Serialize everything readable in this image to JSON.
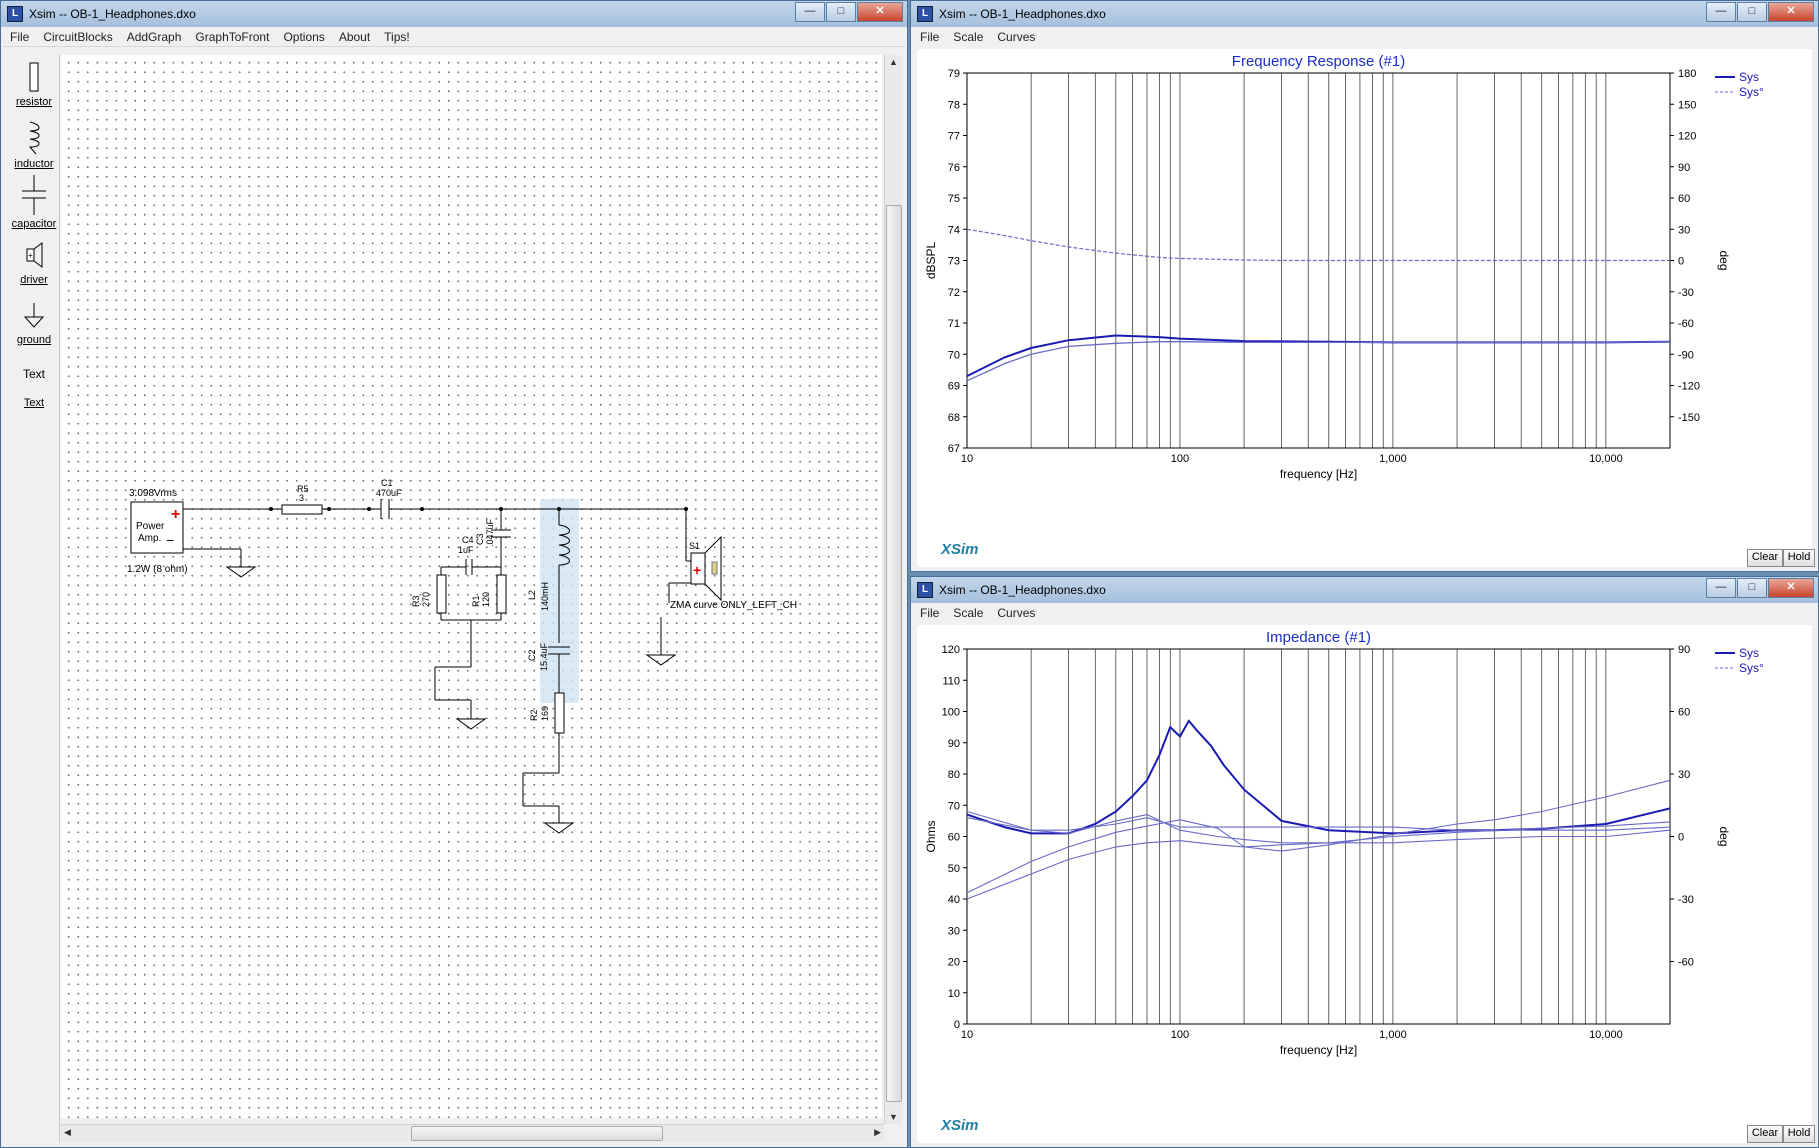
{
  "colors": {
    "series_main": "#1a1ab4",
    "series_phase": "#6a6ac8",
    "grid": "#000000",
    "title": "#1a2ec4"
  },
  "schematic": {
    "title": "Xsim -- OB-1_Headphones.dxo",
    "menu": [
      "File",
      "CircuitBlocks",
      "AddGraph",
      "GraphToFront",
      "Options",
      "About",
      "Tips!"
    ],
    "tools": [
      {
        "label": "resistor",
        "icon": "resistor-icon"
      },
      {
        "label": "inductor",
        "icon": "inductor-icon"
      },
      {
        "label": "capacitor",
        "icon": "capacitor-icon"
      },
      {
        "label": "driver",
        "icon": "driver-icon"
      },
      {
        "label": "ground",
        "icon": "ground-icon"
      },
      {
        "label": "Text",
        "icon": "text-plain"
      },
      {
        "label": "Text",
        "icon": "text-underlined"
      }
    ],
    "circuit": {
      "source_voltage": "3.098Vrms",
      "source_name": "Power",
      "source_name2": "Amp.",
      "source_power": "1.2W (8 ohm)",
      "r5_name": "R5",
      "r5_value": "3",
      "c1_name": "C1",
      "c1_value": "470uF",
      "c3_name": "C3",
      "c3_value": ".047uF",
      "c4_name": "C4",
      "c4_value": "1uF",
      "r3_name": "R3",
      "r3_value": "270",
      "r1_name": "R1",
      "r1_value": "120",
      "l2_name": "L2",
      "l2_value": "140mH",
      "c2_name": "C2",
      "c2_value": "15.4uF",
      "r2_name": "R2",
      "r2_value": "169",
      "s1_name": "S1",
      "s1_curve": "ZMA curve ONLY_LEFT_CH"
    }
  },
  "freq_window": {
    "title": "Xsim -- OB-1_Headphones.dxo",
    "menu": [
      "File",
      "Scale",
      "Curves"
    ],
    "buttons": {
      "clear": "Clear",
      "hold": "Hold"
    },
    "logo": "XSim"
  },
  "imp_window": {
    "title": "Xsim -- OB-1_Headphones.dxo",
    "menu": [
      "File",
      "Scale",
      "Curves"
    ],
    "buttons": {
      "clear": "Clear",
      "hold": "Hold"
    },
    "logo": "XSim"
  },
  "chart_data": [
    {
      "type": "line",
      "title": "Frequency Response (#1)",
      "xlabel": "frequency [Hz]",
      "ylabel": "dBSPL",
      "y2label": "deg",
      "xscale": "log",
      "xlim": [
        10,
        20000
      ],
      "ylim": [
        67,
        79
      ],
      "y2lim": [
        -180,
        180
      ],
      "xticks": [
        10,
        100,
        1000,
        10000
      ],
      "xtick_labels": [
        "10",
        "100",
        "1,000",
        "10,000"
      ],
      "yticks": [
        67,
        68,
        69,
        70,
        71,
        72,
        73,
        74,
        75,
        76,
        77,
        78,
        79
      ],
      "y2ticks": [
        -150,
        -120,
        -90,
        -60,
        -30,
        0,
        30,
        60,
        90,
        120,
        150,
        180
      ],
      "grid": true,
      "legend_position": "top-right",
      "series": [
        {
          "name": "Sys",
          "axis": "left",
          "style": "solid",
          "x": [
            10,
            15,
            20,
            30,
            50,
            80,
            100,
            200,
            500,
            1000,
            2000,
            5000,
            10000,
            20000
          ],
          "y": [
            69.3,
            69.9,
            70.2,
            70.45,
            70.6,
            70.55,
            70.5,
            70.42,
            70.4,
            70.38,
            70.38,
            70.38,
            70.38,
            70.4
          ]
        },
        {
          "name": "",
          "axis": "left",
          "style": "solid-light",
          "x": [
            10,
            15,
            20,
            30,
            50,
            80,
            100,
            200,
            500,
            1000,
            2000,
            5000,
            10000,
            20000
          ],
          "y": [
            69.15,
            69.7,
            70.0,
            70.25,
            70.35,
            70.4,
            70.4,
            70.38,
            70.38,
            70.38,
            70.38,
            70.38,
            70.38,
            70.4
          ]
        },
        {
          "name": "Sys°",
          "axis": "right",
          "style": "dashed",
          "x": [
            10,
            15,
            20,
            30,
            50,
            80,
            100,
            200,
            300,
            500,
            1000,
            2000,
            5000,
            10000,
            20000
          ],
          "y": [
            30,
            24,
            19,
            13,
            7,
            3,
            2,
            0.5,
            0,
            0,
            0,
            0,
            0,
            0,
            0
          ]
        }
      ]
    },
    {
      "type": "line",
      "title": "Impedance (#1)",
      "xlabel": "frequency [Hz]",
      "ylabel": "Ohms",
      "y2label": "deg",
      "xscale": "log",
      "xlim": [
        10,
        20000
      ],
      "ylim": [
        0,
        120
      ],
      "y2lim": [
        -90,
        90
      ],
      "xticks": [
        10,
        100,
        1000,
        10000
      ],
      "xtick_labels": [
        "10",
        "100",
        "1,000",
        "10,000"
      ],
      "yticks": [
        0,
        10,
        20,
        30,
        40,
        50,
        60,
        70,
        80,
        90,
        100,
        110,
        120
      ],
      "y2ticks": [
        -60,
        -30,
        0,
        30,
        60,
        90
      ],
      "grid": true,
      "legend_position": "top-right",
      "series": [
        {
          "name": "Sys",
          "axis": "left",
          "style": "thick",
          "x": [
            10,
            15,
            20,
            30,
            40,
            50,
            60,
            70,
            80,
            90,
            100,
            110,
            120,
            140,
            160,
            200,
            300,
            500,
            1000,
            2000,
            3000,
            5000,
            10000,
            20000
          ],
          "y": [
            67,
            63,
            61,
            61,
            64,
            68,
            73,
            78,
            86,
            95,
            92,
            97,
            94,
            89,
            83,
            75,
            65,
            62,
            61,
            62,
            62,
            62.5,
            64,
            69
          ]
        },
        {
          "name": "",
          "axis": "left",
          "style": "thin",
          "x": [
            10,
            20,
            30,
            50,
            70,
            100,
            150,
            200,
            300,
            500,
            1000,
            2000,
            5000,
            10000,
            20000
          ],
          "y": [
            68,
            62,
            62,
            64,
            66,
            63,
            63,
            63,
            63,
            63,
            63,
            62,
            62,
            62,
            63
          ]
        },
        {
          "name": "",
          "axis": "left",
          "style": "thin",
          "x": [
            10,
            20,
            30,
            50,
            70,
            100,
            150,
            200,
            300,
            500,
            1000,
            2000,
            5000,
            10000,
            20000
          ],
          "y": [
            66,
            62,
            61,
            65,
            67,
            62,
            60,
            59,
            58,
            58,
            58,
            59,
            60,
            60,
            62
          ]
        },
        {
          "name": "Sys°",
          "axis": "right",
          "style": "thin",
          "x": [
            10,
            20,
            30,
            50,
            70,
            100,
            150,
            200,
            300,
            500,
            1000,
            2000,
            3000,
            5000,
            10000,
            20000
          ],
          "y": [
            -27,
            -12,
            -5,
            2,
            5,
            8,
            4,
            -5,
            -7,
            -4,
            1,
            6,
            8,
            12,
            19,
            27
          ]
        },
        {
          "name": "",
          "axis": "right",
          "style": "thin",
          "x": [
            10,
            20,
            30,
            50,
            70,
            100,
            150,
            200,
            300,
            500,
            1000,
            2000,
            5000,
            10000,
            20000
          ],
          "y": [
            -30,
            -18,
            -11,
            -5,
            -3,
            -2,
            -4,
            -5,
            -4,
            -3,
            0,
            2,
            4,
            5,
            7
          ]
        }
      ]
    }
  ]
}
